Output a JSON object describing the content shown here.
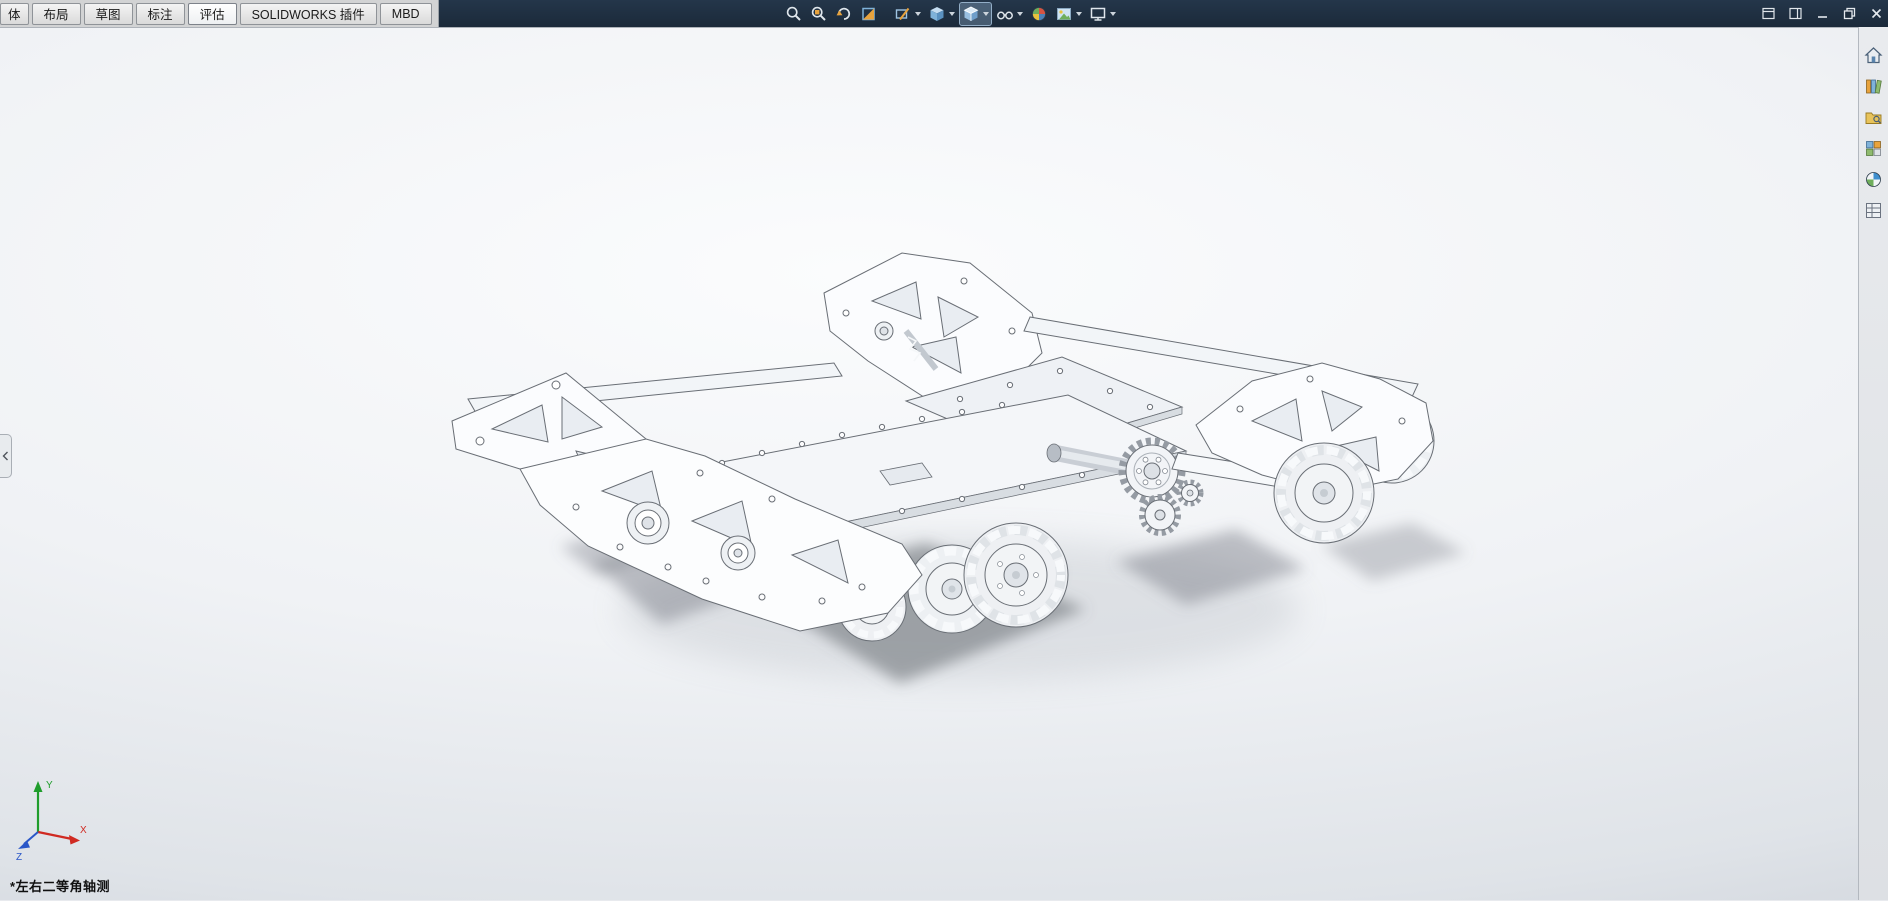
{
  "tabs": {
    "active": "评估",
    "items": [
      {
        "label": "体"
      },
      {
        "label": "布局"
      },
      {
        "label": "草图"
      },
      {
        "label": "标注"
      },
      {
        "label": "评估"
      },
      {
        "label": "SOLIDWORKS 插件"
      },
      {
        "label": "MBD"
      }
    ]
  },
  "heads_up_toolbar": {
    "icons": [
      {
        "name": "zoom-to-fit-icon",
        "dropdown": false,
        "selected": false
      },
      {
        "name": "zoom-area-icon",
        "dropdown": false,
        "selected": false
      },
      {
        "name": "previous-view-icon",
        "dropdown": false,
        "selected": false
      },
      {
        "name": "section-view-icon",
        "dropdown": false,
        "selected": false
      },
      {
        "name": "sketch-visibility-icon",
        "dropdown": true,
        "selected": false
      },
      {
        "name": "view-orientation-icon",
        "dropdown": true,
        "selected": false
      },
      {
        "name": "display-style-icon",
        "dropdown": true,
        "selected": true
      },
      {
        "name": "hide-show-items-icon",
        "dropdown": true,
        "selected": false
      },
      {
        "name": "edit-appearance-icon",
        "dropdown": false,
        "selected": false
      },
      {
        "name": "apply-scene-icon",
        "dropdown": true,
        "selected": false
      },
      {
        "name": "view-settings-icon",
        "dropdown": true,
        "selected": false
      }
    ]
  },
  "window_controls": {
    "icons": [
      {
        "name": "collapse-ribbon-icon"
      },
      {
        "name": "show-taskpane-icon"
      },
      {
        "name": "minimize-icon"
      },
      {
        "name": "restore-icon"
      },
      {
        "name": "close-icon"
      }
    ]
  },
  "task_pane": {
    "icons": [
      {
        "name": "solidworks-resources-icon"
      },
      {
        "name": "design-library-icon"
      },
      {
        "name": "file-explorer-icon"
      },
      {
        "name": "view-palette-icon"
      },
      {
        "name": "appearances-scenes-icon"
      },
      {
        "name": "custom-properties-icon"
      }
    ]
  },
  "viewport": {
    "view_label": "*左右二等角轴测",
    "triad": {
      "x": "X",
      "y": "Y",
      "z": "Z"
    },
    "colors": {
      "titlebar": "#1d2c3c",
      "background_top": "#fbfcfd",
      "background_bottom": "#c9ced6",
      "axis_x": "#d02a22",
      "axis_y": "#1f9d2c",
      "axis_z": "#2a57c8"
    }
  }
}
